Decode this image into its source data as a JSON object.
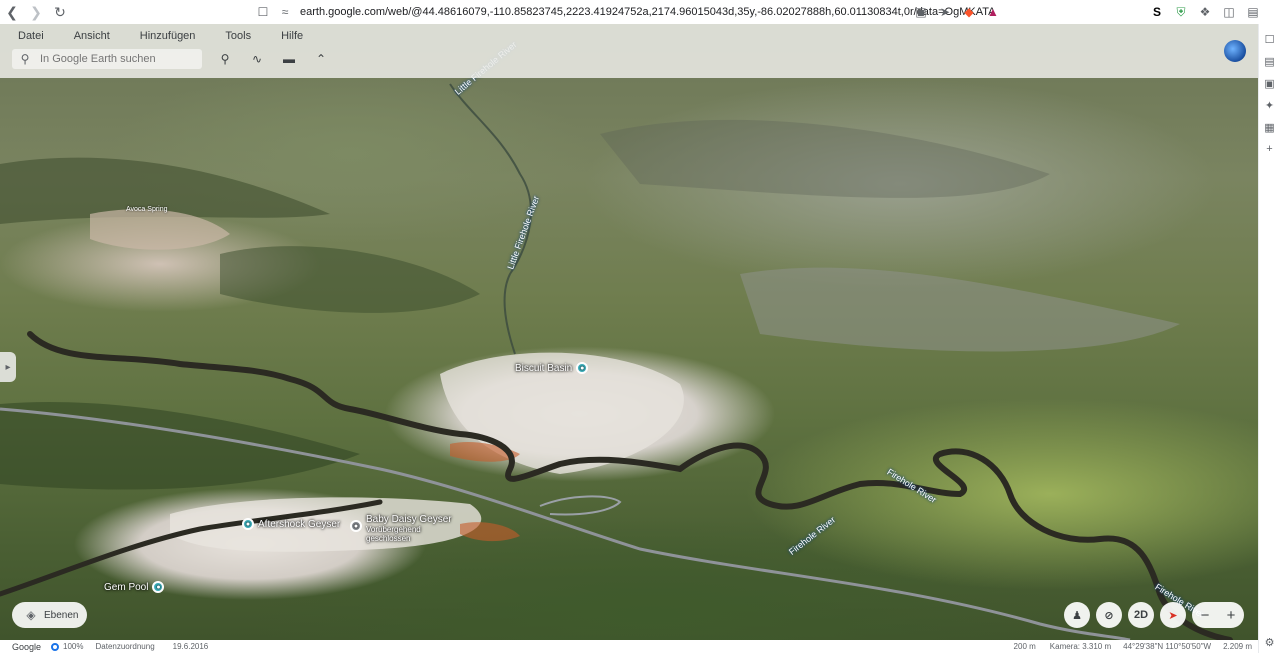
{
  "browser": {
    "url": "earth.google.com/web/@44.48616079,-110.85823745,2223.41924752a,2174.96015043d,35y,-86.02027888h,60.01130834t,0r/data=OgMKATA"
  },
  "menu": {
    "items": [
      "Datei",
      "Ansicht",
      "Hinzufügen",
      "Tools",
      "Hilfe"
    ]
  },
  "search": {
    "placeholder": "In Google Earth suchen"
  },
  "places": [
    {
      "name": "Biscuit Basin"
    },
    {
      "name": "Aftershock Geyser"
    },
    {
      "name": "Baby Daisy Geyser",
      "note": "Vorübergehend geschlossen"
    },
    {
      "name": "Gem Pool"
    }
  ],
  "minor_labels": [
    "Avoca Spring"
  ],
  "rivers": [
    "Little Firehole River",
    "Little Firehole River",
    "Firehole River",
    "Firehole River",
    "Firehole River"
  ],
  "layers_button": "Ebenen",
  "controls": {
    "view_2d": "2D"
  },
  "status": {
    "logo": "Google",
    "zoom": "100%",
    "attribution": "Datenzuordnung",
    "date": "19.6.2016",
    "scale": "200 m",
    "camera": "Kamera: 3.310 m",
    "coords": "44°29'38\"N 110°50'50\"W",
    "elevation": "2.209 m"
  },
  "colors": {
    "river": "#2b2a22",
    "pin": "#3fb7c4",
    "road": "#8f9399"
  }
}
